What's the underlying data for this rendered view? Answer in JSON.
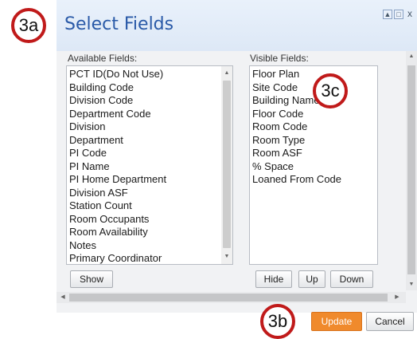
{
  "callouts": {
    "a": "3a",
    "b": "3b",
    "c": "3c"
  },
  "dialog": {
    "title": "Select Fields",
    "controls": {
      "restore": "▲",
      "maximize": "□",
      "close": "x"
    }
  },
  "available": {
    "label": "Available Fields:",
    "items": [
      "PCT ID(Do Not Use)",
      "Building Code",
      "Division Code",
      "Department Code",
      "Division",
      "Department",
      "PI Code",
      "PI Name",
      "PI Home Department",
      "Division ASF",
      "Station Count",
      "Room Occupants",
      "Room Availability",
      "Notes",
      "Primary Coordinator"
    ],
    "show_button": "Show"
  },
  "visible": {
    "label": "Visible Fields:",
    "items": [
      "Floor Plan",
      "Site Code",
      "Building Name",
      "Floor Code",
      "Room Code",
      "Room Type",
      "Room ASF",
      "% Space",
      "Loaned From Code"
    ],
    "buttons": {
      "hide": "Hide",
      "up": "Up",
      "down": "Down"
    }
  },
  "footer": {
    "update": "Update",
    "cancel": "Cancel"
  },
  "colors": {
    "accent": "#f08a2c",
    "title": "#2a5aa8",
    "callout": "#c01a1a"
  }
}
